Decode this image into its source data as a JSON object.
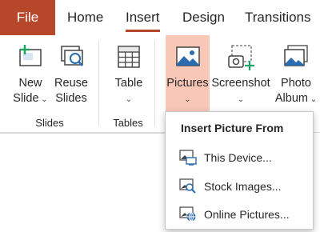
{
  "tabs": {
    "file": "File",
    "home": "Home",
    "insert": "Insert",
    "design": "Design",
    "transitions": "Transitions"
  },
  "ribbon": {
    "new_slide": [
      "New",
      "Slide"
    ],
    "reuse_slides": [
      "Reuse",
      "Slides"
    ],
    "table": "Table",
    "pictures": "Pictures",
    "screenshot": "Screenshot",
    "photo_album": [
      "Photo",
      "Album"
    ],
    "groups": {
      "slides": "Slides",
      "tables": "Tables"
    }
  },
  "dropdown": {
    "title": "Insert Picture From",
    "items": [
      {
        "label": "This Device...",
        "icon": "device-picture-icon"
      },
      {
        "label": "Stock Images...",
        "icon": "stock-images-icon"
      },
      {
        "label": "Online Pictures...",
        "icon": "online-pictures-icon"
      }
    ]
  },
  "colors": {
    "accent": "#b7472a",
    "highlight": "#f8c7b6",
    "icon_blue": "#2b6cb0",
    "icon_green": "#21a366"
  }
}
